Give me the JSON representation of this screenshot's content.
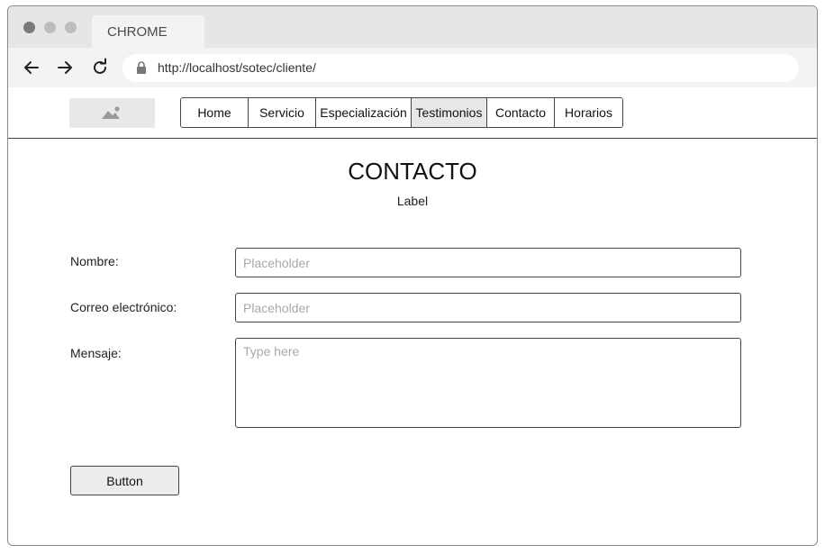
{
  "browser": {
    "tab_title": "CHROME",
    "url": "http://localhost/sotec/cliente/"
  },
  "nav": {
    "items": [
      {
        "label": "Home"
      },
      {
        "label": "Servicio"
      },
      {
        "label": "Especialización"
      },
      {
        "label": "Testimonios",
        "active": true
      },
      {
        "label": "Contacto"
      },
      {
        "label": "Horarios"
      }
    ]
  },
  "main": {
    "title": "CONTACTO",
    "subtitle": "Label"
  },
  "form": {
    "name_label": "Nombre:",
    "name_placeholder": "Placeholder",
    "email_label": "Correo electrónico:",
    "email_placeholder": "Placeholder",
    "message_label": "Mensaje:",
    "message_placeholder": "Type here",
    "submit_label": "Button"
  },
  "icons": {
    "back": "arrow-left-icon",
    "forward": "arrow-right-icon",
    "reload": "reload-icon",
    "lock": "lock-icon",
    "logo": "image-placeholder-icon"
  }
}
